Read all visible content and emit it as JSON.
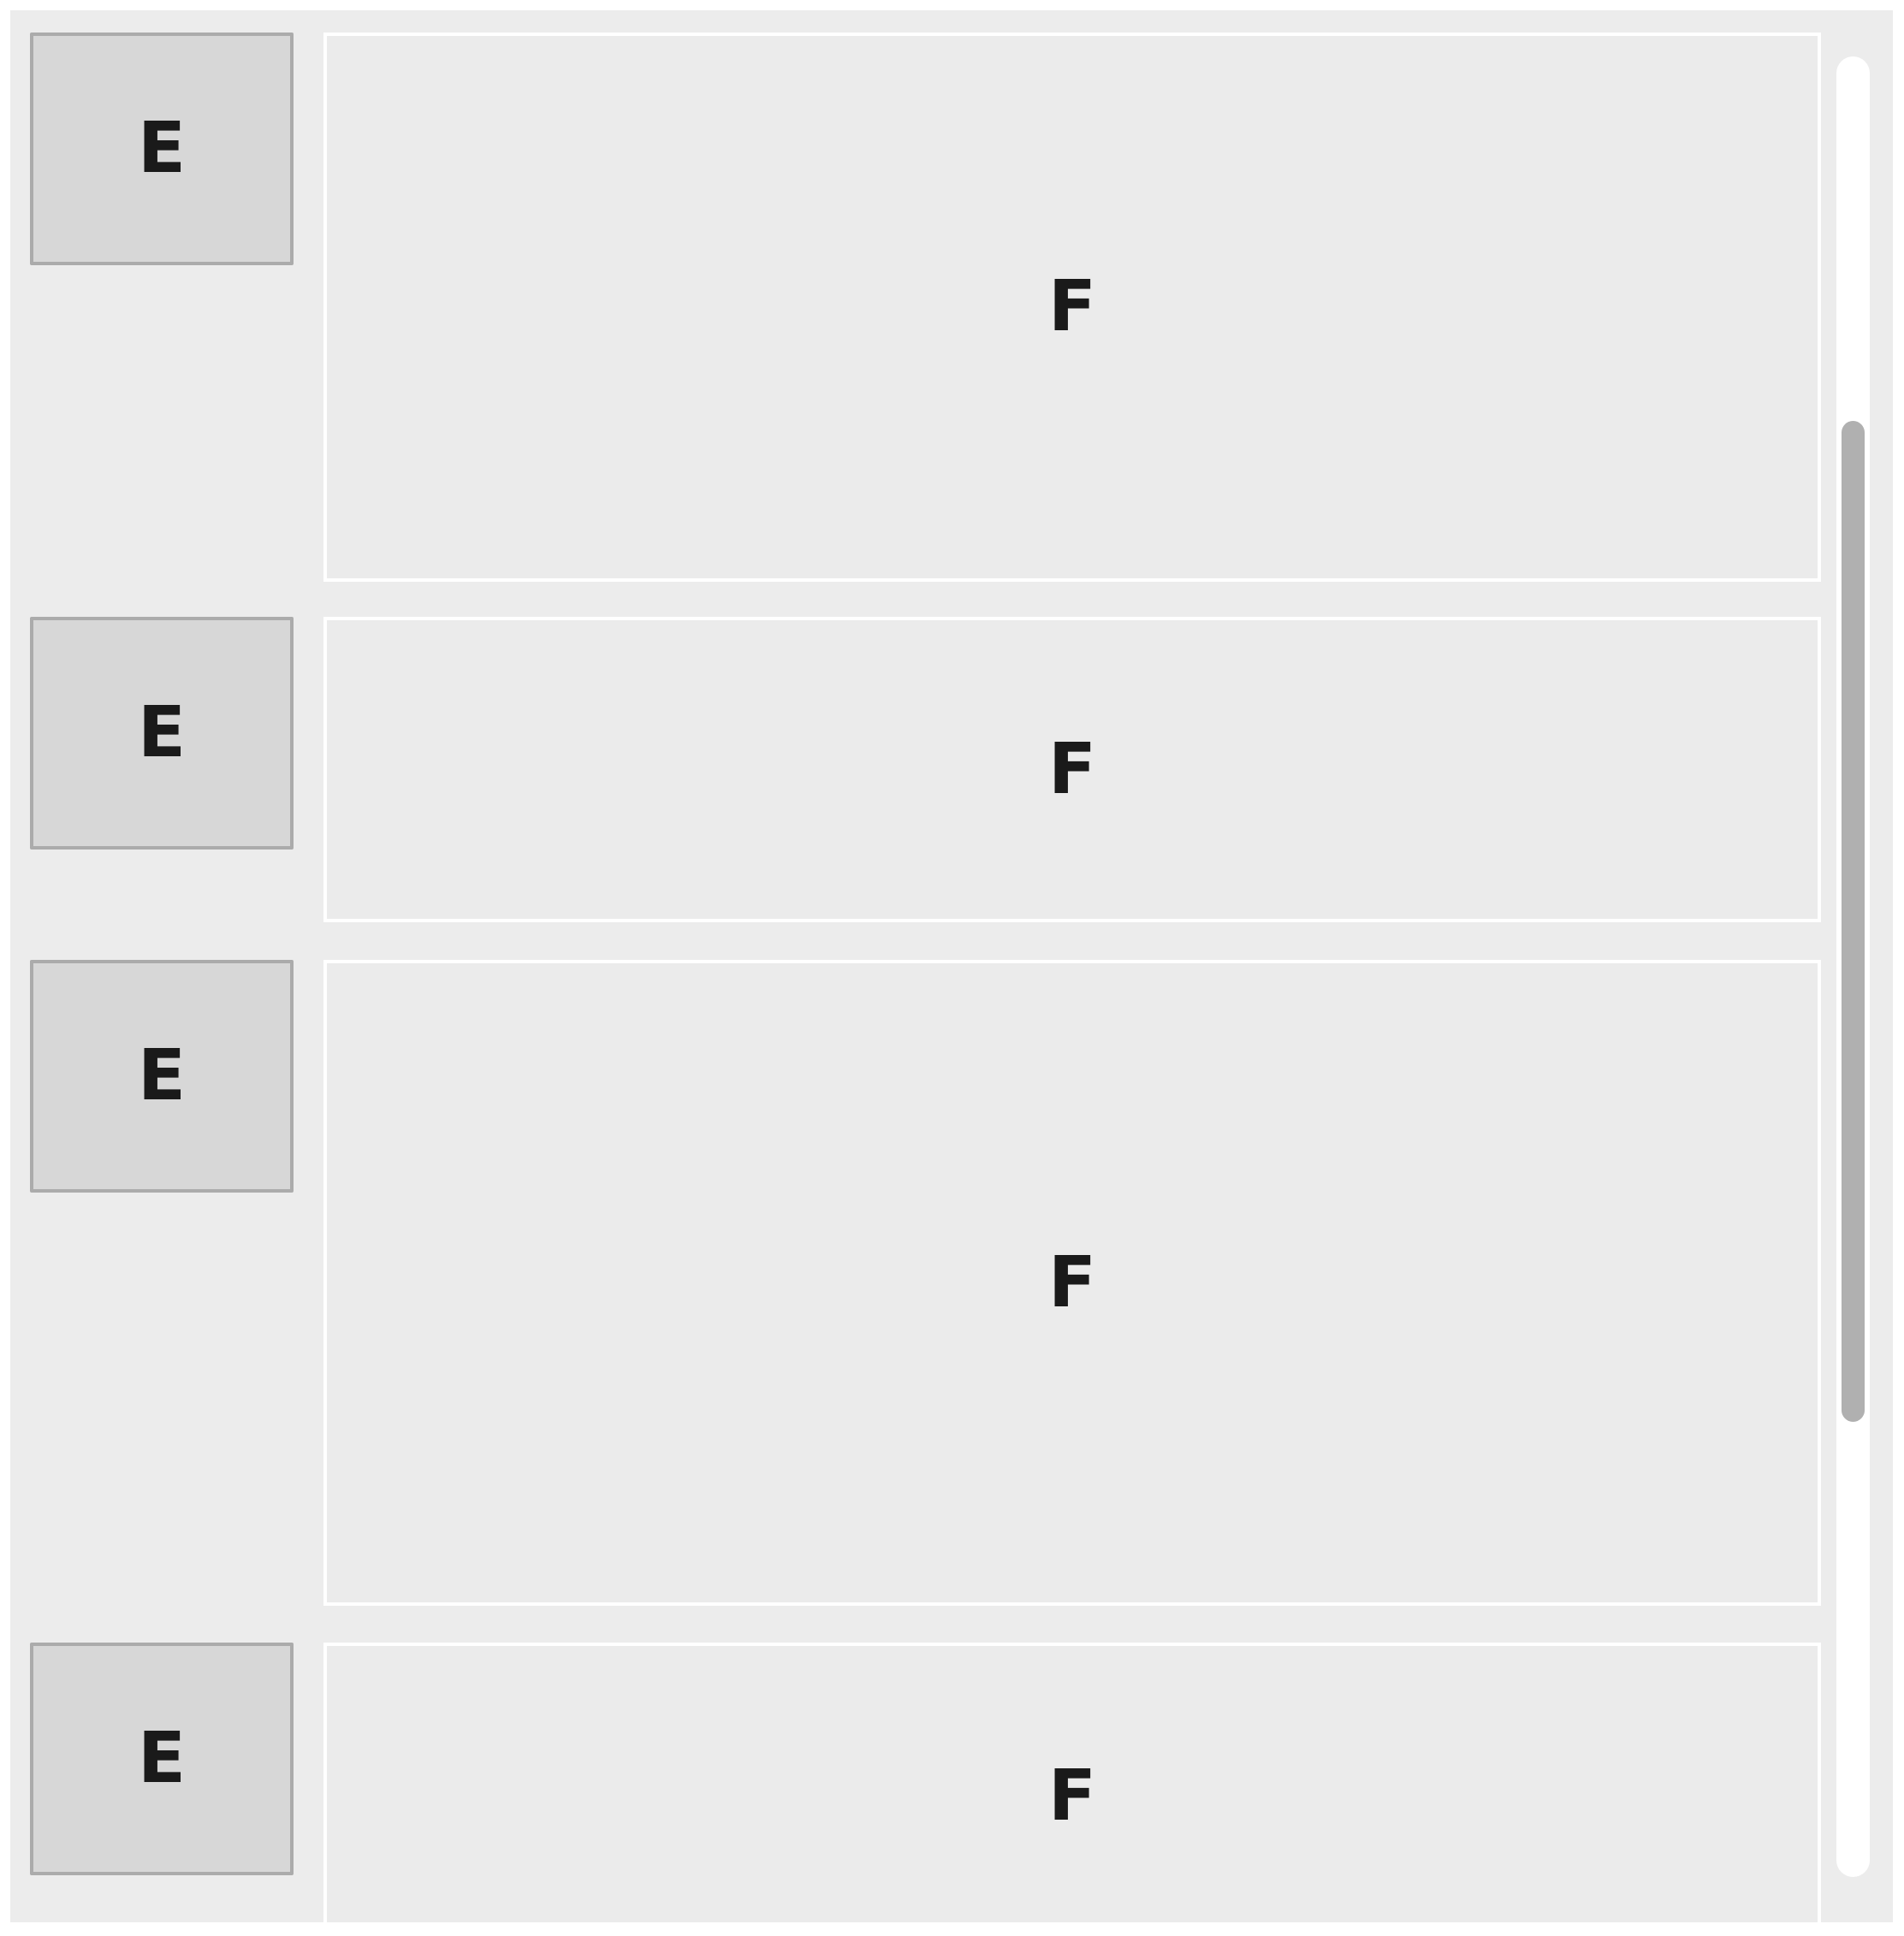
{
  "list": {
    "items": [
      {
        "thumb_label": "E",
        "content_label": "F"
      },
      {
        "thumb_label": "E",
        "content_label": "F"
      },
      {
        "thumb_label": "E",
        "content_label": "F"
      },
      {
        "thumb_label": "E",
        "content_label": "F"
      }
    ]
  },
  "scrollbar": {
    "thumb_start_fraction": 0.2,
    "thumb_size_fraction": 0.55
  },
  "colors": {
    "panel_bg": "#ececec",
    "thumb_bg": "#d7d7d7",
    "thumb_border": "#ababab",
    "content_bg": "#ebebeb",
    "content_border": "#ffffff",
    "text": "#1a1a1a",
    "scroll_track": "#ffffff",
    "scroll_thumb": "#b0b0b0"
  }
}
